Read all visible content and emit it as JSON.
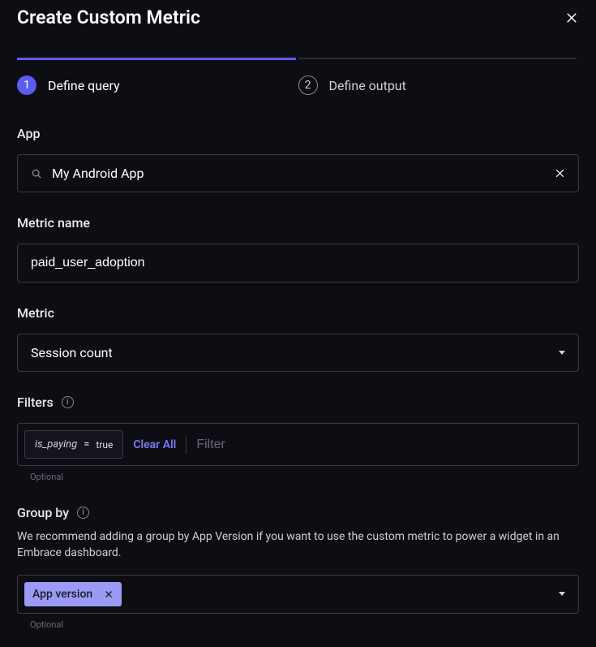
{
  "header": {
    "title": "Create Custom Metric"
  },
  "steps": [
    {
      "number": "1",
      "label": "Define query"
    },
    {
      "number": "2",
      "label": "Define output"
    }
  ],
  "app": {
    "label": "App",
    "value": "My Android App"
  },
  "metricName": {
    "label": "Metric name",
    "value": "paid_user_adoption"
  },
  "metric": {
    "label": "Metric",
    "value": "Session count"
  },
  "filters": {
    "label": "Filters",
    "chip": {
      "key": "is_paying",
      "op": "=",
      "value": "true"
    },
    "clearAll": "Clear All",
    "placeholder": "Filter",
    "optional": "Optional"
  },
  "groupBy": {
    "label": "Group by",
    "hint": "We recommend adding a group by App Version if you want to use the custom metric to power a widget in an Embrace dashboard.",
    "chip": "App version",
    "optional": "Optional"
  }
}
